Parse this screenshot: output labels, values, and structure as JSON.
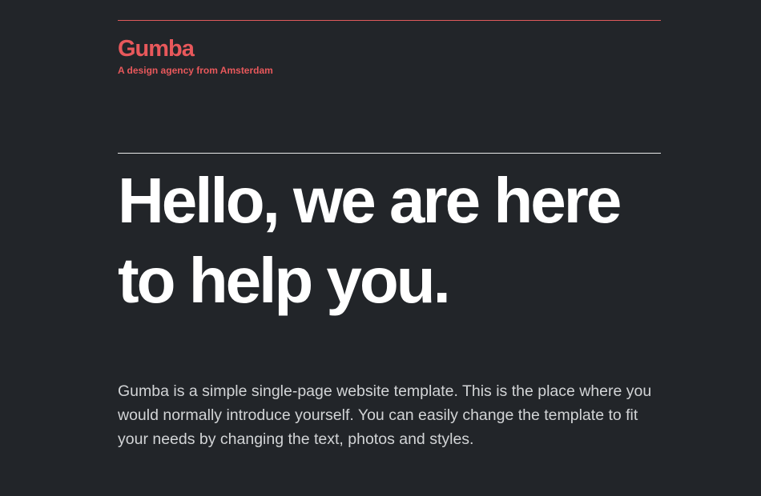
{
  "header": {
    "brand": "Gumba",
    "tagline": "A design agency from Amsterdam"
  },
  "hero": {
    "line1": "Hello, we are here",
    "line2": "to help you."
  },
  "intro": {
    "text": "Gumba is a simple single-page website template. This is the place where you would normally introduce yourself. You can easily change the template to fit your needs by changing the text, photos and styles."
  },
  "colors": {
    "background": "#222529",
    "accent": "#e8585b",
    "heading": "#ffffff",
    "body_text": "#d2d4d6"
  }
}
